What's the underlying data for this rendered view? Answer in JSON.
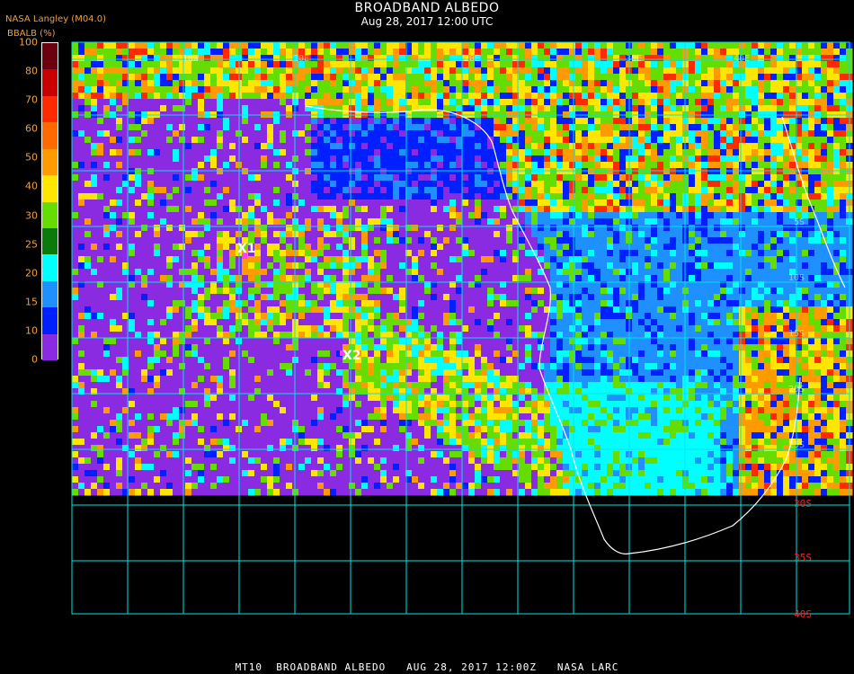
{
  "header": {
    "title": "BROADBAND ALBEDO",
    "subtitle": "Aug 28, 2017 12:00 UTC",
    "organization": "NASA Langley (M04.0)",
    "scale_label": "BBALB (%)"
  },
  "legend": {
    "ticks": [
      "100",
      "80",
      "70",
      "60",
      "50",
      "40",
      "30",
      "25",
      "20",
      "15",
      "10",
      "0"
    ],
    "colors": [
      "#6a0010",
      "#c80000",
      "#ff2a00",
      "#ff6a00",
      "#ff9a00",
      "#ffe600",
      "#66dd00",
      "#0a7a0a",
      "#00ffff",
      "#1e90ff",
      "#0020ff",
      "#8a2be2"
    ]
  },
  "colors": {
    "grid": "#00e5e5",
    "ocean": "#8a2be2",
    "coast": "#ffffff",
    "lat_label": "#ff2020"
  },
  "latitude_labels": [
    "30S",
    "35S",
    "40S"
  ],
  "top_labels": [
    "10W",
    "10E",
    "20E",
    "30E",
    "40E"
  ],
  "inner_labels": [
    "5S",
    "10S",
    "15S",
    "20S",
    "25S"
  ],
  "markers": [
    {
      "label": "X1",
      "color": "#ff40ff"
    },
    {
      "label": "X2",
      "color": "#ff40ff"
    }
  ],
  "footer": "MT10  BROADBAND ALBEDO   AUG 28, 2017 12:00Z   NASA LARC"
}
